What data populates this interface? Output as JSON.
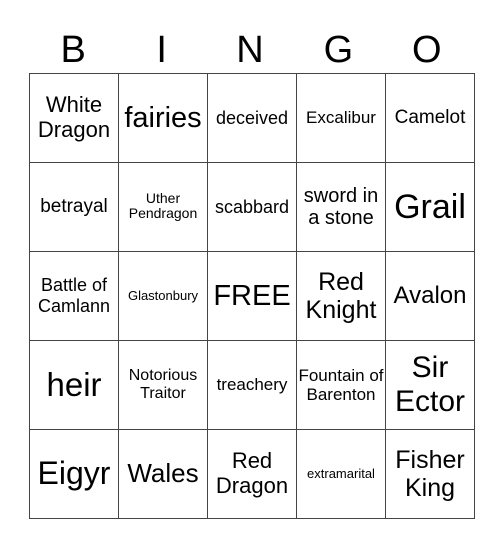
{
  "header": [
    "B",
    "I",
    "N",
    "G",
    "O"
  ],
  "cells": [
    [
      {
        "text": "White Dragon",
        "size": 22
      },
      {
        "text": "fairies",
        "size": 29
      },
      {
        "text": "deceived",
        "size": 18
      },
      {
        "text": "Excalibur",
        "size": 17
      },
      {
        "text": "Camelot",
        "size": 19
      }
    ],
    [
      {
        "text": "betrayal",
        "size": 19
      },
      {
        "text": "Uther Pendragon",
        "size": 14
      },
      {
        "text": "scabbard",
        "size": 18
      },
      {
        "text": "sword in a stone",
        "size": 20
      },
      {
        "text": "Grail",
        "size": 34
      }
    ],
    [
      {
        "text": "Battle of Camlann",
        "size": 18
      },
      {
        "text": "Glastonbury",
        "size": 13
      },
      {
        "text": "FREE",
        "size": 29
      },
      {
        "text": "Red Knight",
        "size": 25
      },
      {
        "text": "Avalon",
        "size": 24
      }
    ],
    [
      {
        "text": "heir",
        "size": 33
      },
      {
        "text": "Notorious Traitor",
        "size": 16
      },
      {
        "text": "treachery",
        "size": 17
      },
      {
        "text": "Fountain of Barenton",
        "size": 17
      },
      {
        "text": "Sir Ector",
        "size": 30
      }
    ],
    [
      {
        "text": "Eigyr",
        "size": 32
      },
      {
        "text": "Wales",
        "size": 26
      },
      {
        "text": "Red Dragon",
        "size": 22
      },
      {
        "text": "extramarital",
        "size": 13
      },
      {
        "text": "Fisher King",
        "size": 25
      }
    ]
  ]
}
